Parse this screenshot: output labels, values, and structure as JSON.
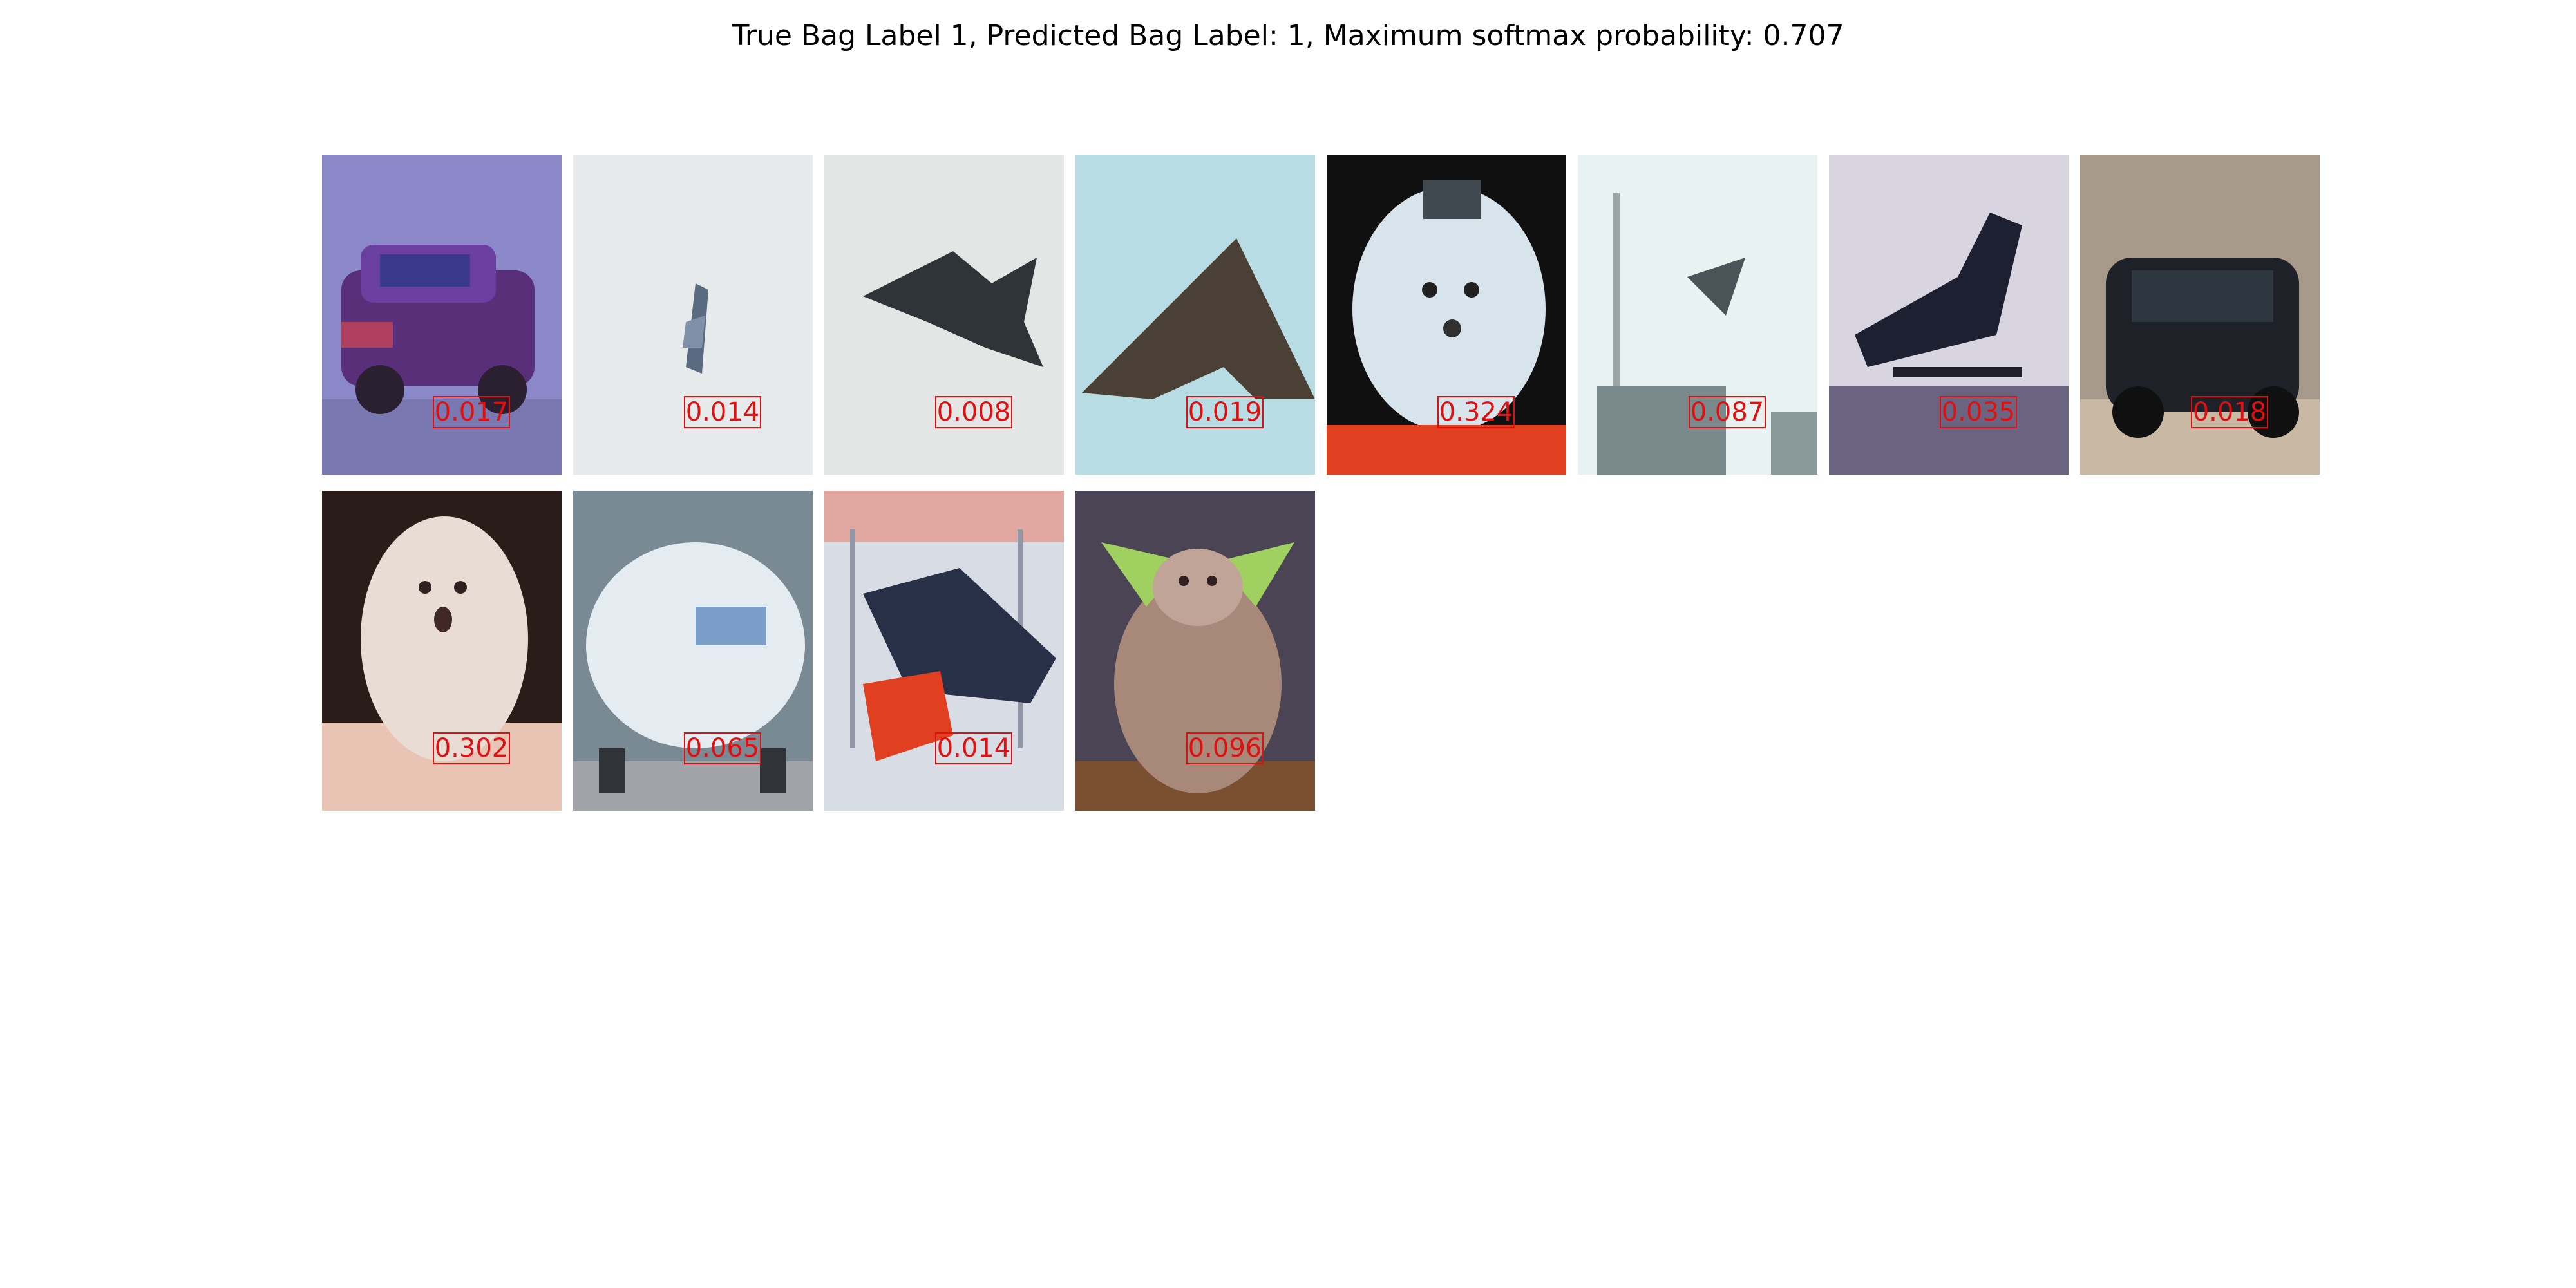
{
  "title": "True Bag Label 1, Predicted Bag Label: 1, Maximum softmax probability: 0.707",
  "tiles": [
    {
      "subject": "car",
      "score": "0.017"
    },
    {
      "subject": "airplane",
      "score": "0.014"
    },
    {
      "subject": "airplane",
      "score": "0.008"
    },
    {
      "subject": "airplane",
      "score": "0.019"
    },
    {
      "subject": "dog",
      "score": "0.324"
    },
    {
      "subject": "airplane",
      "score": "0.087"
    },
    {
      "subject": "airplane",
      "score": "0.035"
    },
    {
      "subject": "car",
      "score": "0.018"
    },
    {
      "subject": "dog",
      "score": "0.302"
    },
    {
      "subject": "truck",
      "score": "0.065"
    },
    {
      "subject": "airplane",
      "score": "0.014"
    },
    {
      "subject": "dog",
      "score": "0.096"
    }
  ],
  "colors": {
    "score_label": "#e01010",
    "title_text": "#000000",
    "background": "#ffffff"
  }
}
